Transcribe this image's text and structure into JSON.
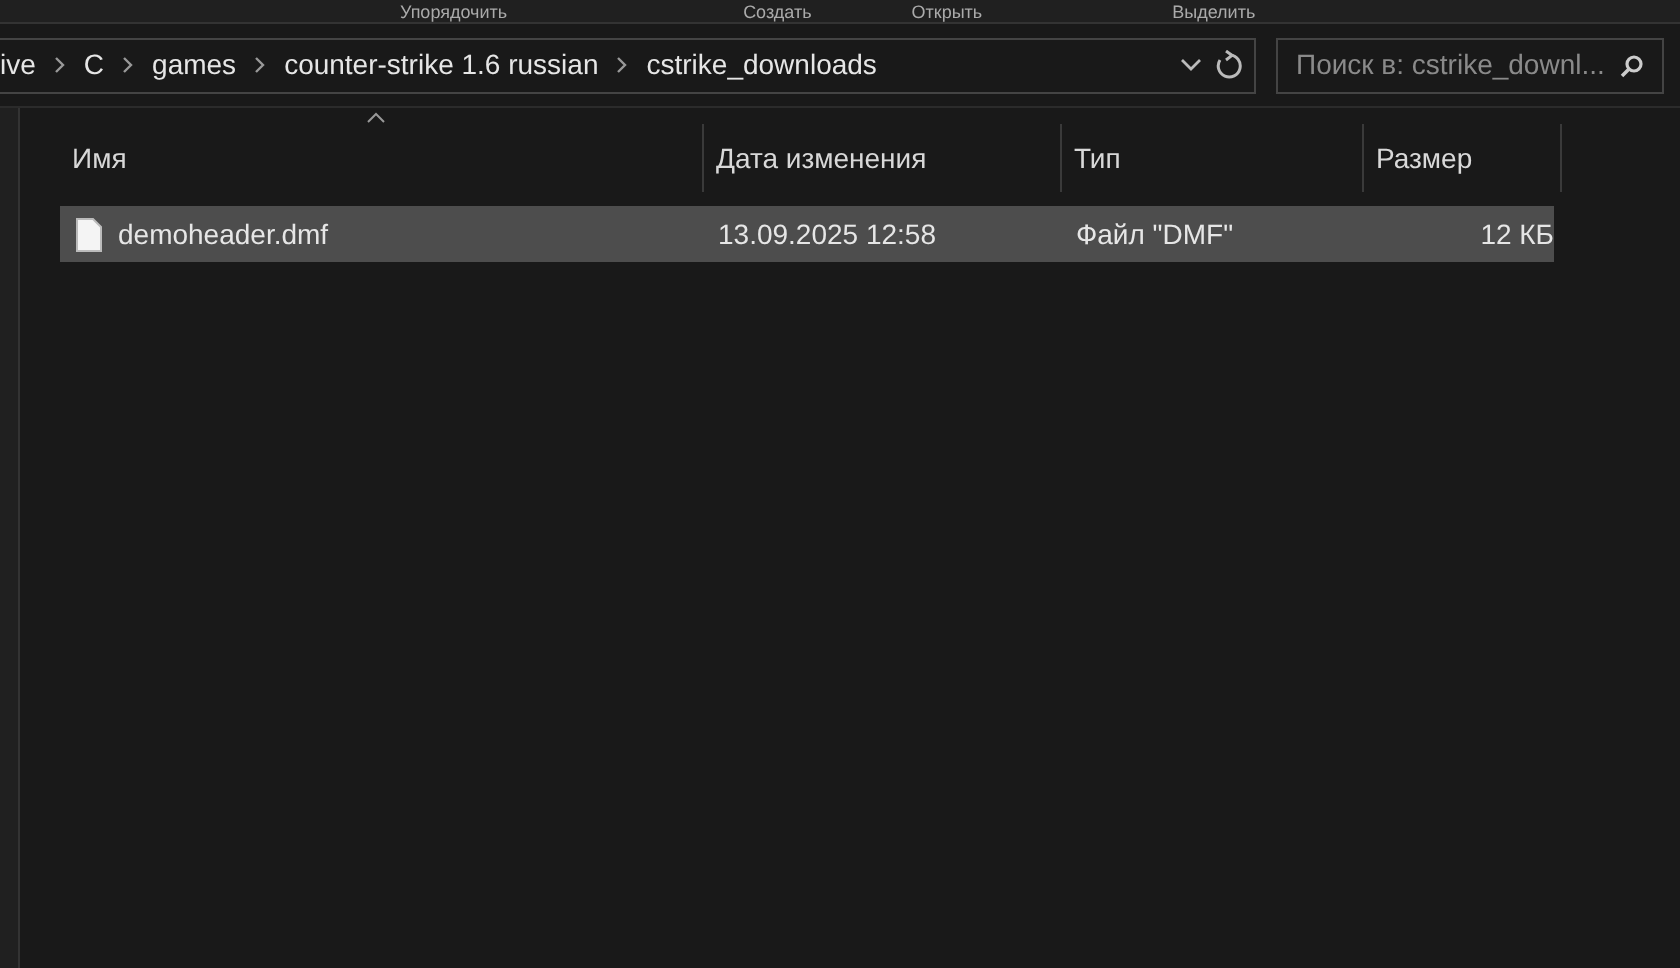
{
  "ribbon": {
    "groups": [
      "Упорядочить",
      "Создать",
      "Открыть",
      "Выделить"
    ]
  },
  "address_bar": {
    "path": [
      "ive",
      "C",
      "games",
      "counter-strike 1.6 russian",
      "cstrike_downloads"
    ]
  },
  "search": {
    "placeholder": "Поиск в: cstrike_downl..."
  },
  "table": {
    "columns": [
      "Имя",
      "Дата изменения",
      "Тип",
      "Размер"
    ],
    "rows": [
      {
        "name": "demoheader.dmf",
        "date": "13.09.2025 12:58",
        "type": "Файл \"DMF\"",
        "size": "12 КБ",
        "selected": true
      }
    ]
  }
}
